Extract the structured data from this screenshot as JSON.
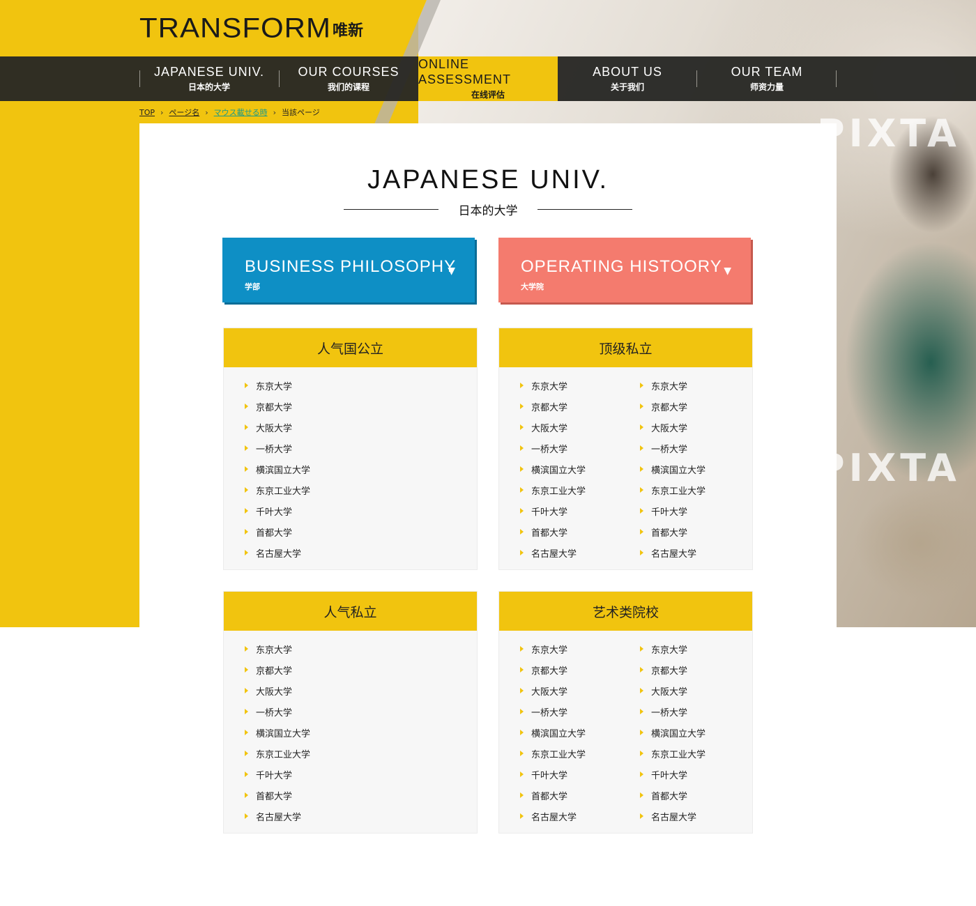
{
  "colors": {
    "brand_yellow": "#f1c40f",
    "nav_dark": "#282824",
    "feature_blue": "#0e8fc5",
    "feature_red": "#f47b6e",
    "breadcrumb_highlight": "#1a9a8a"
  },
  "header": {
    "logo_text": "TRANSFORM",
    "logo_subtext": "唯新"
  },
  "hero": {
    "watermark": "PIXTA"
  },
  "nav": {
    "items": [
      {
        "en": "JAPANESE UNIV.",
        "cn": "日本的大学",
        "active": false
      },
      {
        "en": "OUR COURSES",
        "cn": "我们的课程",
        "active": false
      },
      {
        "en": "ONLINE ASSESSMENT",
        "cn": "在线评估",
        "active": true
      },
      {
        "en": "ABOUT US",
        "cn": "关于我们",
        "active": false
      },
      {
        "en": "OUR TEAM",
        "cn": "师资力量",
        "active": false
      }
    ]
  },
  "breadcrumb": {
    "items": [
      "TOP",
      "ページ名",
      "マウス載せる時",
      "当該ページ"
    ]
  },
  "page": {
    "title_en": "JAPANESE UNIV.",
    "title_cn": "日本的大学"
  },
  "features": [
    {
      "en": "BUSINESS PHILOSOPHY",
      "cn": "学部",
      "arrow": "▼"
    },
    {
      "en": "OPERATING HISTOORY",
      "cn": "大学院",
      "arrow": "▼"
    }
  ],
  "cards": [
    {
      "title": "人气国公立",
      "columns": [
        [
          "东京大学",
          "京都大学",
          "大阪大学",
          "一桥大学",
          "横滨国立大学",
          "东京工业大学",
          "千叶大学",
          "首都大学",
          "名古屋大学"
        ]
      ]
    },
    {
      "title": "顶级私立",
      "columns": [
        [
          "东京大学",
          "京都大学",
          "大阪大学",
          "一桥大学",
          "横滨国立大学",
          "东京工业大学",
          "千叶大学",
          "首都大学",
          "名古屋大学"
        ],
        [
          "东京大学",
          "京都大学",
          "大阪大学",
          "一桥大学",
          "横滨国立大学",
          "东京工业大学",
          "千叶大学",
          "首都大学",
          "名古屋大学"
        ]
      ]
    },
    {
      "title": "人气私立",
      "columns": [
        [
          "东京大学",
          "京都大学",
          "大阪大学",
          "一桥大学",
          "横滨国立大学",
          "东京工业大学",
          "千叶大学",
          "首都大学",
          "名古屋大学"
        ]
      ]
    },
    {
      "title": "艺术类院校",
      "columns": [
        [
          "东京大学",
          "京都大学",
          "大阪大学",
          "一桥大学",
          "横滨国立大学",
          "东京工业大学",
          "千叶大学",
          "首都大学",
          "名古屋大学"
        ],
        [
          "东京大学",
          "京都大学",
          "大阪大学",
          "一桥大学",
          "横滨国立大学",
          "东京工业大学",
          "千叶大学",
          "首都大学",
          "名古屋大学"
        ]
      ]
    }
  ]
}
